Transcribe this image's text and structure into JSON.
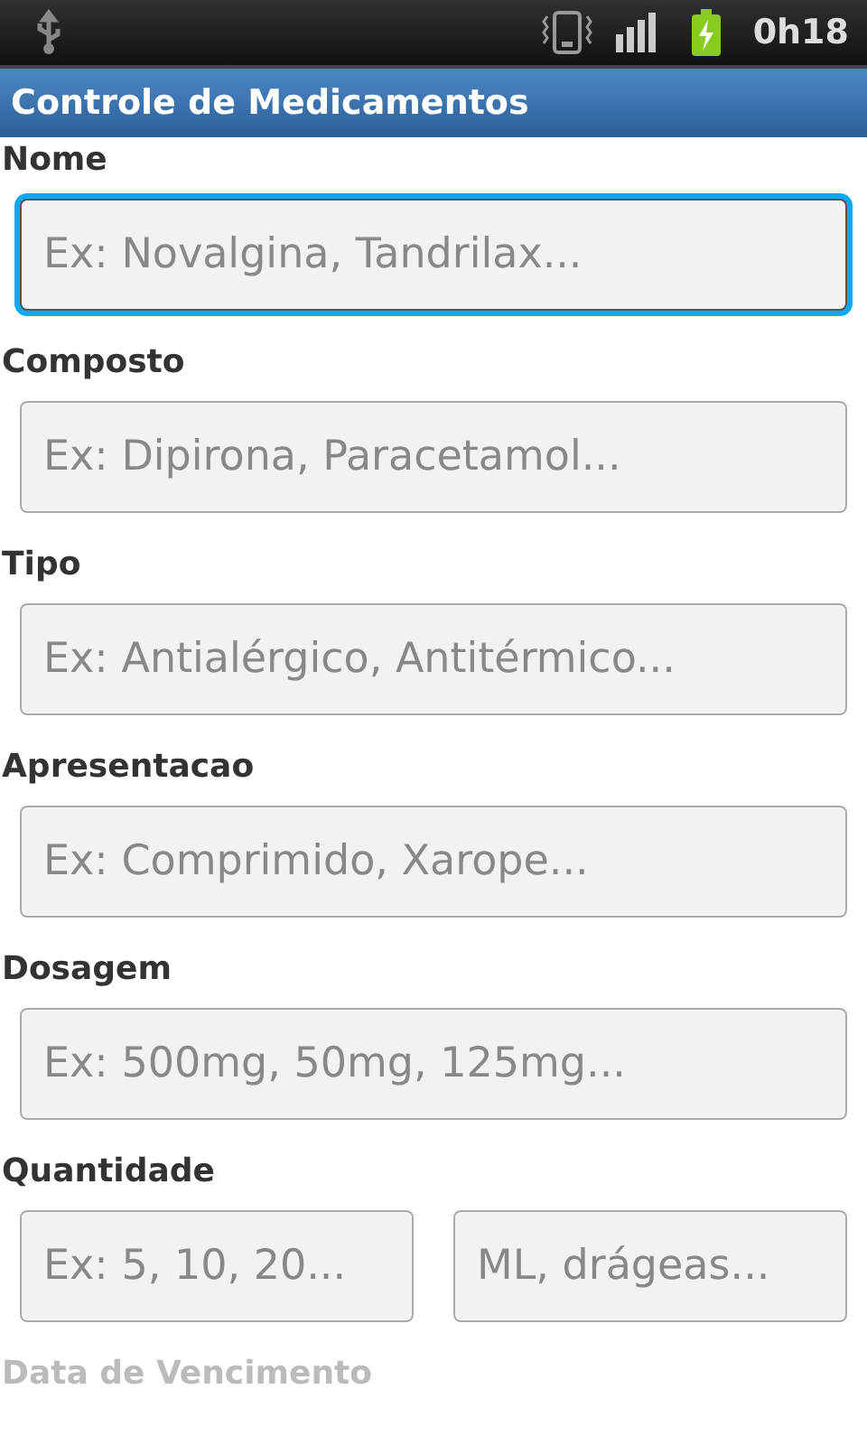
{
  "status_bar": {
    "time": "0h18"
  },
  "title": "Controle de Medicamentos",
  "fields": [
    {
      "kind": "single",
      "label": "Nome",
      "inputs": [
        {
          "placeholder": "Ex: Novalgina, Tandrilax...",
          "focused": true
        }
      ]
    },
    {
      "kind": "single",
      "label": "Composto",
      "inputs": [
        {
          "placeholder": "Ex: Dipirona, Paracetamol...",
          "focused": false
        }
      ]
    },
    {
      "kind": "single",
      "label": "Tipo",
      "inputs": [
        {
          "placeholder": "Ex: Antialérgico, Antitérmico...",
          "focused": false
        }
      ]
    },
    {
      "kind": "single",
      "label": "Apresentacao",
      "inputs": [
        {
          "placeholder": "Ex: Comprimido, Xarope...",
          "focused": false
        }
      ]
    },
    {
      "kind": "single",
      "label": "Dosagem",
      "inputs": [
        {
          "placeholder": "Ex: 500mg, 50mg, 125mg...",
          "focused": false
        }
      ]
    },
    {
      "kind": "pair",
      "label": "Quantidade",
      "inputs": [
        {
          "placeholder": "Ex: 5, 10, 20...",
          "focused": false
        },
        {
          "placeholder": "ML, drágeas...",
          "focused": false
        }
      ]
    },
    {
      "kind": "faded",
      "label": "Data de Vencimento"
    }
  ]
}
